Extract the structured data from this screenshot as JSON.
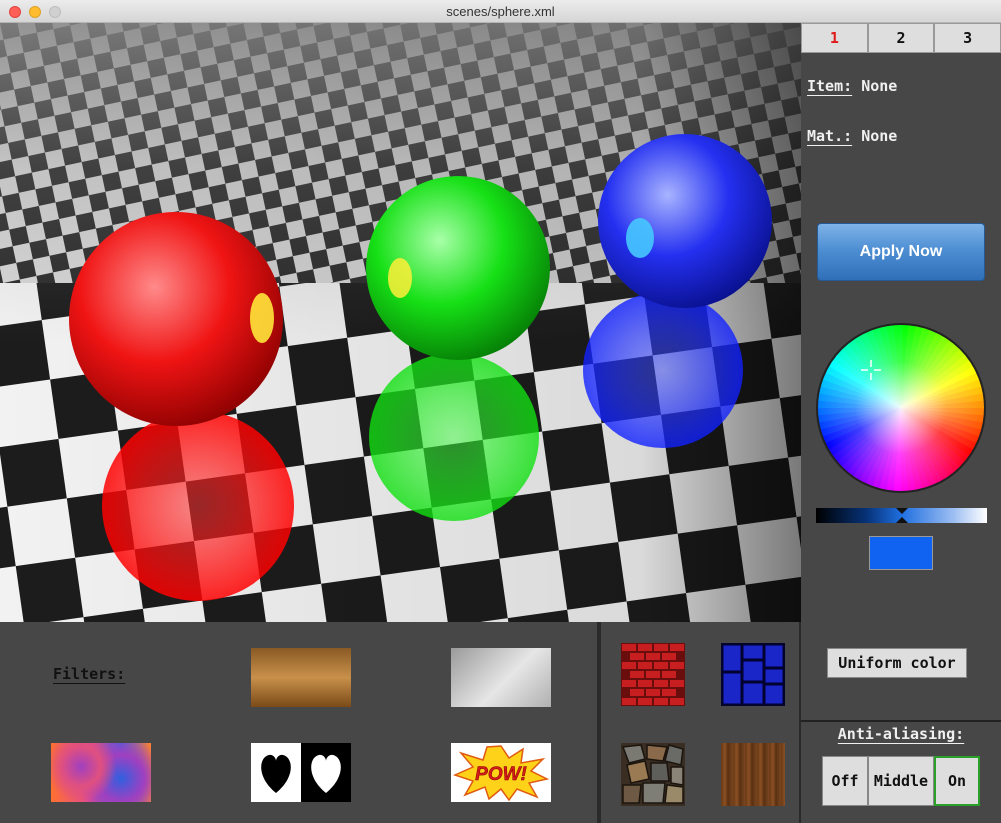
{
  "window": {
    "title": "scenes/sphere.xml"
  },
  "tabs": [
    {
      "label": "1",
      "active": true
    },
    {
      "label": "2",
      "active": false
    },
    {
      "label": "3",
      "active": false
    }
  ],
  "info": {
    "item_label": "Item:",
    "item_value": "None",
    "mat_label": "Mat.:",
    "mat_value": "None"
  },
  "apply_button": {
    "label": "Apply Now"
  },
  "color": {
    "selected_hex": "#0f63f0"
  },
  "uniform_button": {
    "label": "Uniform color"
  },
  "antialiasing": {
    "label": "Anti-aliasing:",
    "options": [
      {
        "label": "Off"
      },
      {
        "label": "Middle"
      },
      {
        "label": "On"
      }
    ],
    "selected": "On"
  },
  "filters": {
    "label": "Filters:",
    "items": [
      {
        "name": "wood-gradient-filter"
      },
      {
        "name": "silver-gradient-filter"
      },
      {
        "name": "psychedelic-filter"
      },
      {
        "name": "hearts-inverse-filter"
      },
      {
        "name": "pow-comic-filter",
        "text": "POW!"
      }
    ]
  },
  "textures": [
    {
      "name": "red-brick-texture"
    },
    {
      "name": "blue-tile-texture"
    },
    {
      "name": "stone-texture"
    },
    {
      "name": "wood-texture"
    }
  ]
}
